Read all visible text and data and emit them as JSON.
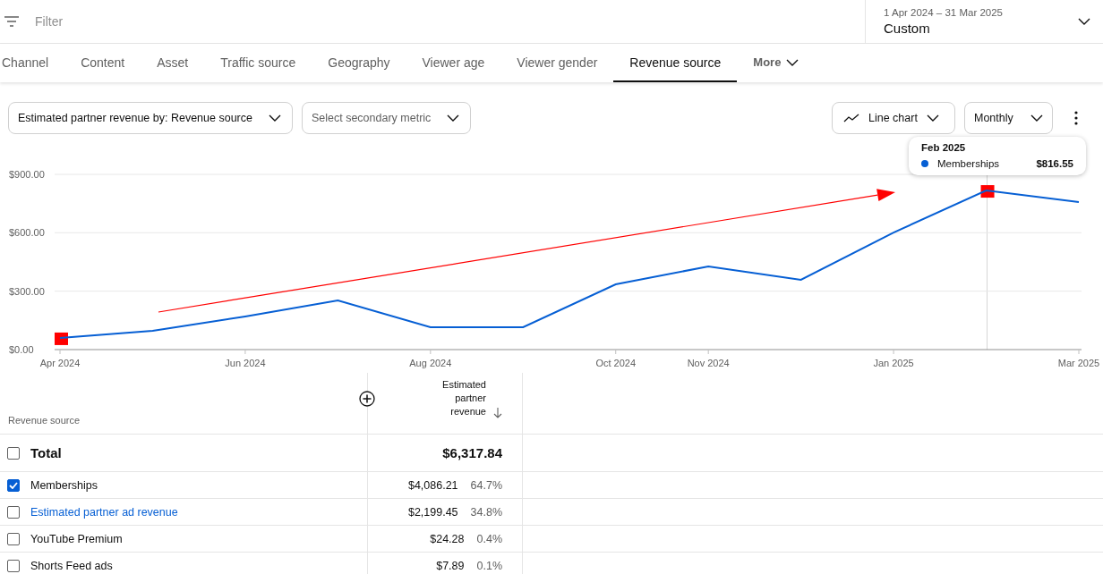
{
  "filter": {
    "placeholder": "Filter"
  },
  "date_range": {
    "range": "1 Apr 2024 – 31 Mar 2025",
    "label": "Custom"
  },
  "tabs": [
    {
      "label": "Channel",
      "selected": false
    },
    {
      "label": "Content",
      "selected": false
    },
    {
      "label": "Asset",
      "selected": false
    },
    {
      "label": "Traffic source",
      "selected": false
    },
    {
      "label": "Geography",
      "selected": false
    },
    {
      "label": "Viewer age",
      "selected": false
    },
    {
      "label": "Viewer gender",
      "selected": false
    },
    {
      "label": "Revenue source",
      "selected": true
    }
  ],
  "more": "More",
  "metric_select": {
    "value": "Estimated partner revenue by: Revenue source"
  },
  "secondary_select": {
    "placeholder": "Select secondary metric"
  },
  "chart_type": "Line chart",
  "interval": "Monthly",
  "chart_data": {
    "type": "line",
    "categories": [
      "Apr 2024",
      null,
      "Jun 2024",
      null,
      "Aug 2024",
      null,
      "Oct 2024",
      "Nov 2024",
      null,
      "Jan 2025",
      null,
      "Mar 2025"
    ],
    "yticks": [
      {
        "value": 0,
        "label": "$0.00"
      },
      {
        "value": 300,
        "label": "$300.00"
      },
      {
        "value": 600,
        "label": "$600.00"
      },
      {
        "value": 900,
        "label": "$900.00"
      }
    ],
    "ylim": [
      0,
      900
    ],
    "series": [
      {
        "name": "Memberships",
        "color": "#065fd4",
        "values": [
          60,
          96,
          170,
          252,
          115,
          115,
          335,
          427,
          358,
          601,
          817,
          757
        ]
      }
    ]
  },
  "tooltip": {
    "title": "Feb 2025",
    "value": "$816.55"
  },
  "table": {
    "columns": [
      "Revenue source",
      "Estimated partner revenue"
    ],
    "total": {
      "label": "Total",
      "value": "$6,317.84",
      "checked": false
    },
    "rows": [
      {
        "name": "Memberships",
        "value": "$4,086.21",
        "share": "64.7%",
        "checked": true,
        "kind": "plain"
      },
      {
        "name": "Estimated partner ad revenue",
        "value": "$2,199.45",
        "share": "34.8%",
        "checked": false,
        "kind": "link"
      },
      {
        "name": "YouTube Premium",
        "value": "$24.28",
        "share": "0.4%",
        "checked": false,
        "kind": "plain"
      },
      {
        "name": "Shorts Feed ads",
        "value": "$7.89",
        "share": "0.1%",
        "checked": false,
        "kind": "plain"
      }
    ]
  }
}
